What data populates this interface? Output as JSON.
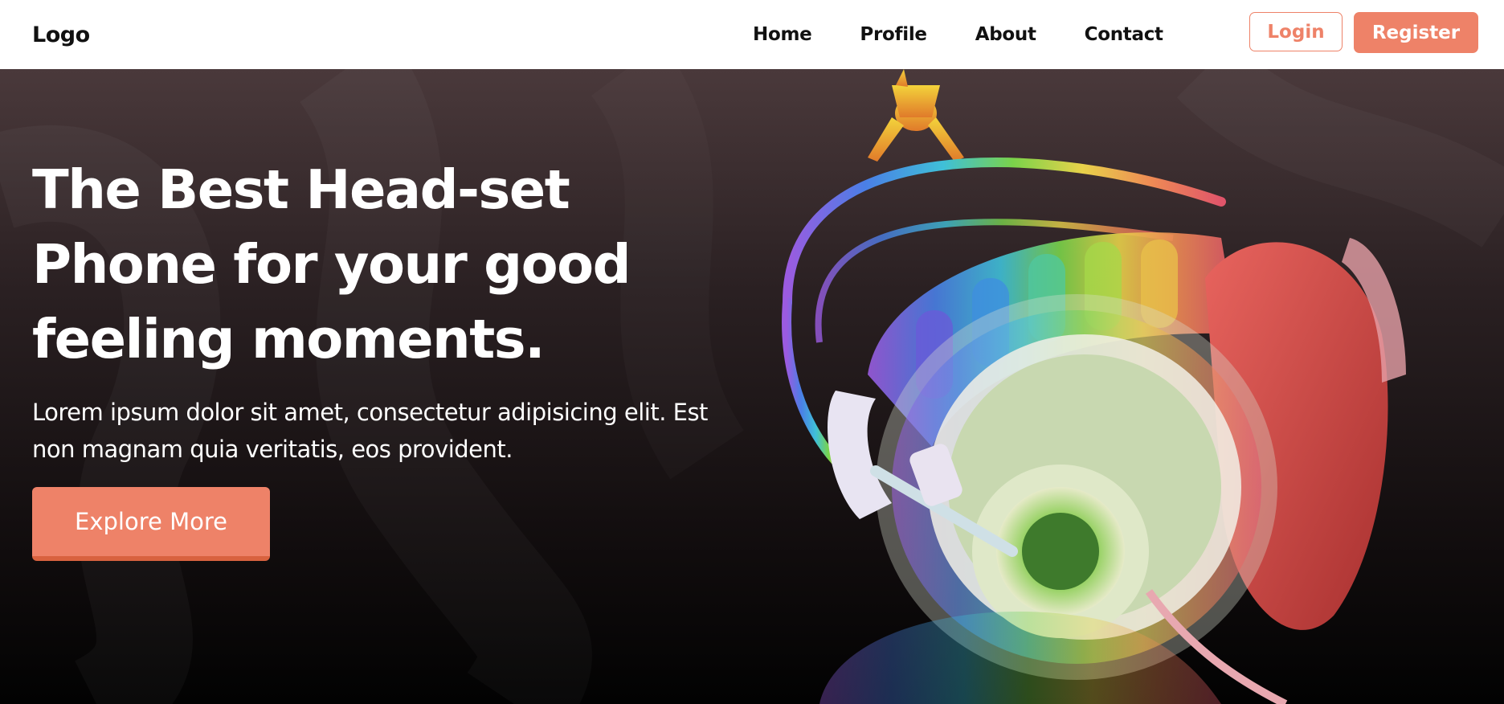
{
  "navbar": {
    "logo": "Logo",
    "links": [
      "Home",
      "Profile",
      "About",
      "Contact"
    ],
    "login_label": "Login",
    "register_label": "Register"
  },
  "hero": {
    "title_lines": [
      "The Best Head-set",
      "Phone for your good",
      "feeling moments."
    ],
    "description": "Lorem ipsum dolor sit amet, consectetur adipisicing elit. Est non magnam quia veritatis, eos provident.",
    "cta_label": "Explore More"
  },
  "colors": {
    "accent": "#ee8268",
    "nav_bg": "#ffffff",
    "hero_bg_top": "#4a393b",
    "hero_bg_bottom": "#020202"
  }
}
